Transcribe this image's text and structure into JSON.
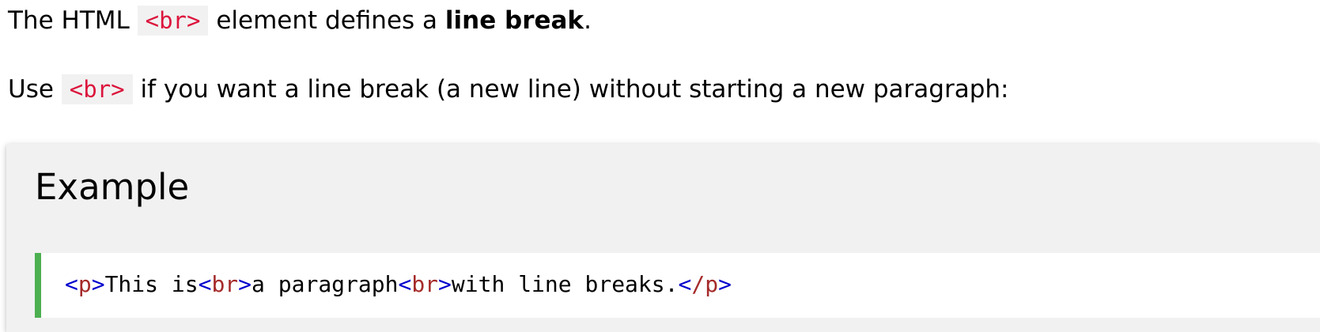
{
  "intro": {
    "p1_before": "The HTML ",
    "p1_code": "<br>",
    "p1_middle": " element defines a ",
    "p1_bold": "line break",
    "p1_end": ".",
    "p2_before": "Use ",
    "p2_code": "<br>",
    "p2_after": " if you want a line break (a new line) without starting a new paragraph:"
  },
  "example": {
    "title": "Example",
    "code": {
      "lt": "<",
      "gt": ">",
      "slash": "/",
      "tag_p": "p",
      "tag_br": "br",
      "text_1": "This is",
      "text_2": "a paragraph",
      "text_3": "with line breaks."
    }
  },
  "colors": {
    "inline_code_text": "#dc143c",
    "inline_code_bg": "#f1f1f1",
    "example_bg": "#f1f1f1",
    "accent_border": "#4caf50",
    "tag_bracket": "#0000cd",
    "tag_name": "#a52a2a"
  }
}
